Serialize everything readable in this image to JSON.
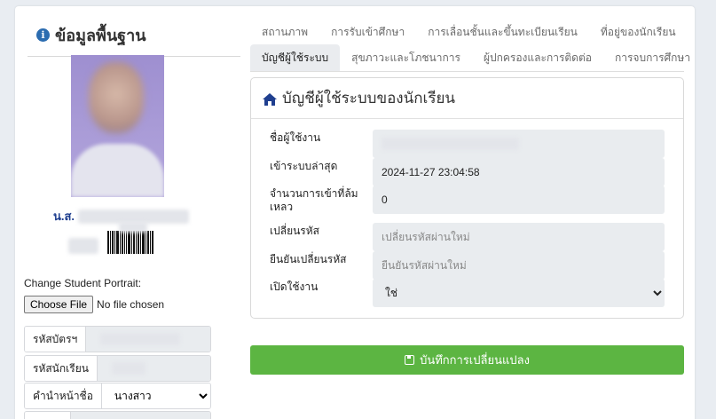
{
  "left": {
    "title": "ข้อมูลพื้นฐาน",
    "name_prefix": "น.ส.",
    "portrait_label": "Change Student Portrait:",
    "file_button": "Choose File",
    "file_status": "No file chosen",
    "fields": [
      {
        "label": "รหัสบัตรฯ"
      },
      {
        "label": "รหัสนักเรียน"
      },
      {
        "label": "คำนำหน้าชื่อ",
        "value": "นางสาว"
      }
    ]
  },
  "tabs": {
    "row1": [
      "สถานภาพ",
      "การรับเข้าศึกษา",
      "การเลื่อนชั้นและขึ้นทะเบียนเรียน",
      "ที่อยู่ของนักเรียน"
    ],
    "row2": [
      "บัญชีผู้ใช้ระบบ",
      "สุขภาวะและโภชนาการ",
      "ผู้ปกครองและการติดต่อ",
      "การจบการศึกษา"
    ],
    "active": "บัญชีผู้ใช้ระบบ"
  },
  "panel": {
    "title": "บัญชีผู้ใช้ระบบของนักเรียน",
    "rows": [
      {
        "label": "ชื่อผู้ใช้งาน"
      },
      {
        "label": "เข้าระบบล่าสุด",
        "value": "2024-11-27 23:04:58"
      },
      {
        "label": "จำนวนการเข้าที่ล้มเหลว",
        "value": "0"
      },
      {
        "label": "เปลี่ยนรหัส",
        "placeholder": "เปลี่ยนรหัสผ่านใหม่"
      },
      {
        "label": "ยืนยันเปลี่ยนรหัส",
        "placeholder": "ยืนยันรหัสผ่านใหม่"
      },
      {
        "label": "เปิดใช้งาน",
        "value": "ใช่"
      }
    ]
  },
  "save_button": "บันทึกการเปลี่ยนแปลง",
  "colors": {
    "accent": "#5cb542",
    "link": "#1f3f8f",
    "icon": "#2b6cb0"
  }
}
